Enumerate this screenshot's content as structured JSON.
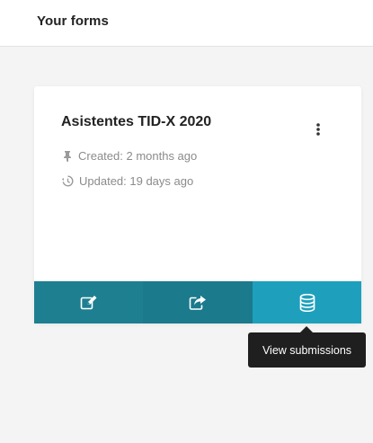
{
  "header": {
    "title": "Your forms"
  },
  "form_card": {
    "title": "Asistentes TID-X 2020",
    "created_text": "Created: 2 months ago",
    "updated_text": "Updated: 19 days ago",
    "menu_icon": "kebab-menu-icon",
    "created_icon": "pin-icon",
    "updated_icon": "history-icon",
    "actions": [
      {
        "name": "edit",
        "icon": "edit-icon",
        "color": "#1e7f91"
      },
      {
        "name": "share",
        "icon": "share-icon",
        "color": "#1b7a8c"
      },
      {
        "name": "submissions",
        "icon": "database-icon",
        "color": "#1ea0bc"
      }
    ]
  },
  "tooltip": {
    "text": "View submissions"
  },
  "colors": {
    "background": "#f4f4f4",
    "card": "#ffffff",
    "text_primary": "#222222",
    "text_muted": "#8b8b8b",
    "tooltip_bg": "#1f1f1f"
  }
}
